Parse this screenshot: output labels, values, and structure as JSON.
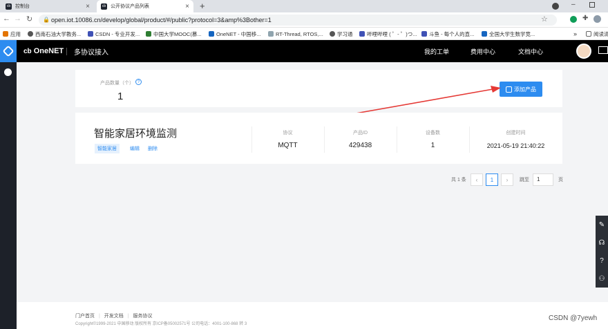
{
  "browser": {
    "tabs": [
      {
        "label": "控制台",
        "active": false
      },
      {
        "label": "公开协议产品列表",
        "active": true
      }
    ],
    "url": "open.iot.10086.cn/develop/global/product/#/public?protocol=3&amp%3Bother=1",
    "bookmarks": [
      "应用",
      "西南石油大学教务...",
      "CSDN - 专业开发...",
      "中国大学MOOC(慕...",
      "OneNET - 中国移...",
      "RT-Thread, RTOS,...",
      "学习通",
      "哔哩哔哩 ( ゜- ゜)つ...",
      "斗鱼 - 每个人的直...",
      "全国大学生数学竞...",
      "阅读清单"
    ]
  },
  "header": {
    "logo": "OneNET",
    "section": "多协议接入",
    "nav": [
      "我的工单",
      "费用中心",
      "文档中心"
    ]
  },
  "summary": {
    "count_label": "产品数量（个）",
    "count_value": "1",
    "add_button": "添加产品"
  },
  "product": {
    "name": "智能家居环境监测",
    "tag": "智能家居",
    "edit": "编辑",
    "delete": "删除",
    "columns": [
      {
        "label": "协议",
        "value": "MQTT"
      },
      {
        "label": "产品ID",
        "value": "429438"
      },
      {
        "label": "设备数",
        "value": "1"
      },
      {
        "label": "创建时间",
        "value": "2021-05-19 21:40:22"
      }
    ]
  },
  "pagination": {
    "total": "共 1 条",
    "current": "1",
    "jump_label": "跳至",
    "jump_value": "1",
    "page_unit": "页"
  },
  "footer": {
    "links": [
      "门户首页",
      "开发文档",
      "服务协议"
    ],
    "copyright": "Copyright©1999-2021 中国移动 版权所有 京ICP备05002571号 公司电话：4001-100-868 转 3"
  },
  "watermark": "CSDN @7yewh",
  "colors": {
    "accent": "#2d8cf0",
    "arrow": "#e53935",
    "nav_bg": "#000000",
    "sidebar_bg": "#1d2129"
  }
}
